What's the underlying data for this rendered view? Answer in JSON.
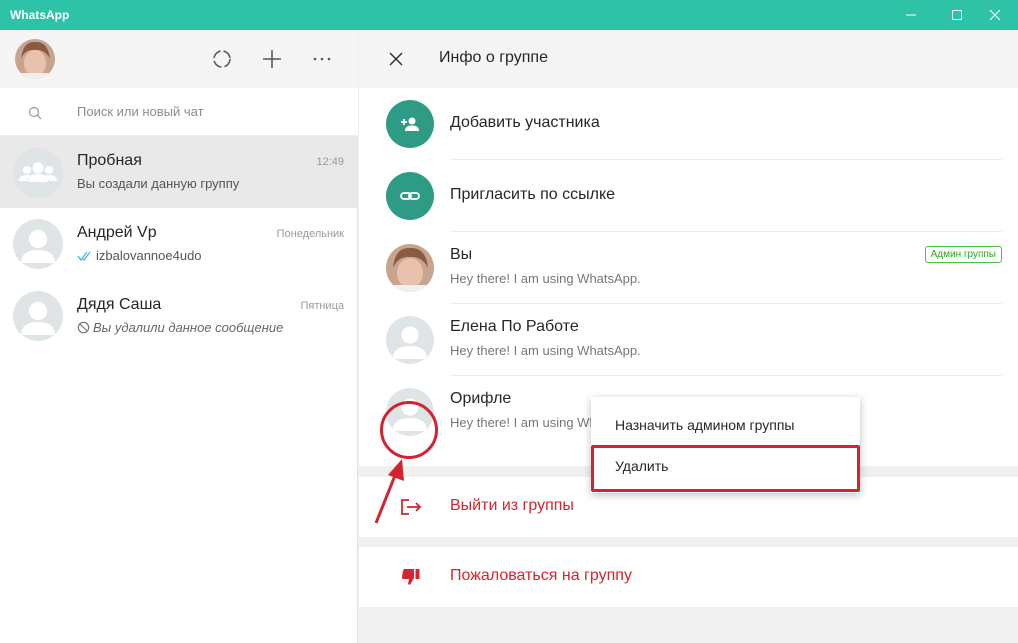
{
  "window": {
    "title": "WhatsApp"
  },
  "search": {
    "placeholder": "Поиск или новый чат"
  },
  "chats": [
    {
      "name": "Пробная",
      "time": "12:49",
      "message": "Вы создали данную группу"
    },
    {
      "name": "Андрей Vp",
      "time": "Понедельник",
      "message": "izbalovannoe4udo"
    },
    {
      "name": "Дядя Саша",
      "time": "Пятница",
      "message": "Вы удалили данное сообщение"
    }
  ],
  "group_info": {
    "title": "Инфо о группе",
    "add_participant": "Добавить участника",
    "invite_link": "Пригласить по ссылке",
    "members": [
      {
        "name": "Вы",
        "status": "Hey there! I am using WhatsApp.",
        "badge": "Админ группы"
      },
      {
        "name": "Елена По Работе",
        "status": "Hey there! I am using WhatsApp."
      },
      {
        "name": "Орифле",
        "status": "Hey there! I am using WhatsApp."
      }
    ],
    "exit_group": "Выйти из группы",
    "report_group": "Пожаловаться на группу"
  },
  "context_menu": {
    "items": [
      "Назначить админом группы",
      "Удалить"
    ]
  },
  "colors": {
    "accent": "#2ec2a6",
    "teal": "#2e9b85",
    "danger": "#d4262e",
    "annotation": "#d42330"
  }
}
